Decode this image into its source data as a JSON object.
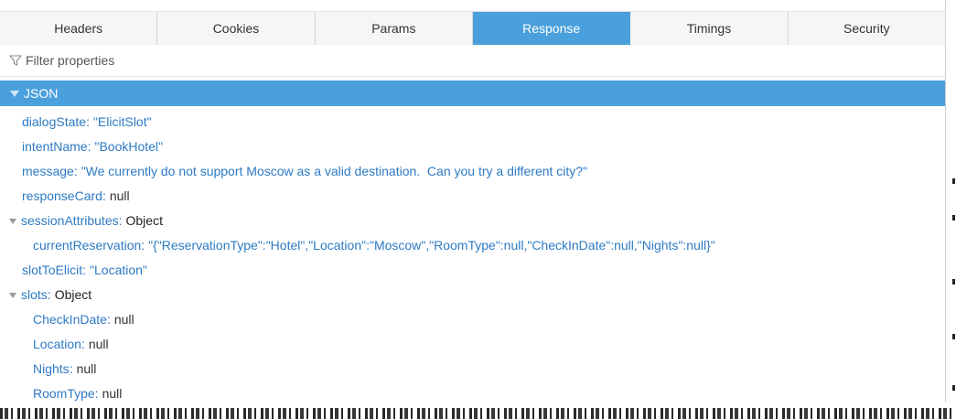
{
  "tabs": [
    {
      "label": "Headers"
    },
    {
      "label": "Cookies"
    },
    {
      "label": "Params"
    },
    {
      "label": "Response"
    },
    {
      "label": "Timings"
    },
    {
      "label": "Security"
    }
  ],
  "active_tab": "Response",
  "filter": {
    "placeholder": "Filter properties"
  },
  "json_header": "JSON",
  "tree": {
    "dialogState": {
      "key": "dialogState",
      "value": "\"ElicitSlot\""
    },
    "intentName": {
      "key": "intentName",
      "value": "\"BookHotel\""
    },
    "message": {
      "key": "message",
      "value": "\"We currently do not support Moscow as a valid destination.  Can you try a different city?\""
    },
    "responseCard": {
      "key": "responseCard",
      "value": "null"
    },
    "sessionAttributes": {
      "key": "sessionAttributes",
      "value": "Object"
    },
    "currentReservation": {
      "key": "currentReservation",
      "value": "\"{\"ReservationType\":\"Hotel\",\"Location\":\"Moscow\",\"RoomType\":null,\"CheckInDate\":null,\"Nights\":null}\""
    },
    "slotToElicit": {
      "key": "slotToElicit",
      "value": "\"Location\""
    },
    "slots": {
      "key": "slots",
      "value": "Object"
    },
    "CheckInDate": {
      "key": "CheckInDate",
      "value": "null"
    },
    "Location": {
      "key": "Location",
      "value": "null"
    },
    "Nights": {
      "key": "Nights",
      "value": "null"
    },
    "RoomType": {
      "key": "RoomType",
      "value": "null"
    }
  },
  "colors": {
    "accent": "#4aa0dc",
    "key": "#2d7ac4"
  },
  "icons": {
    "filter": "funnel-icon",
    "expand": "triangle-down-icon"
  }
}
